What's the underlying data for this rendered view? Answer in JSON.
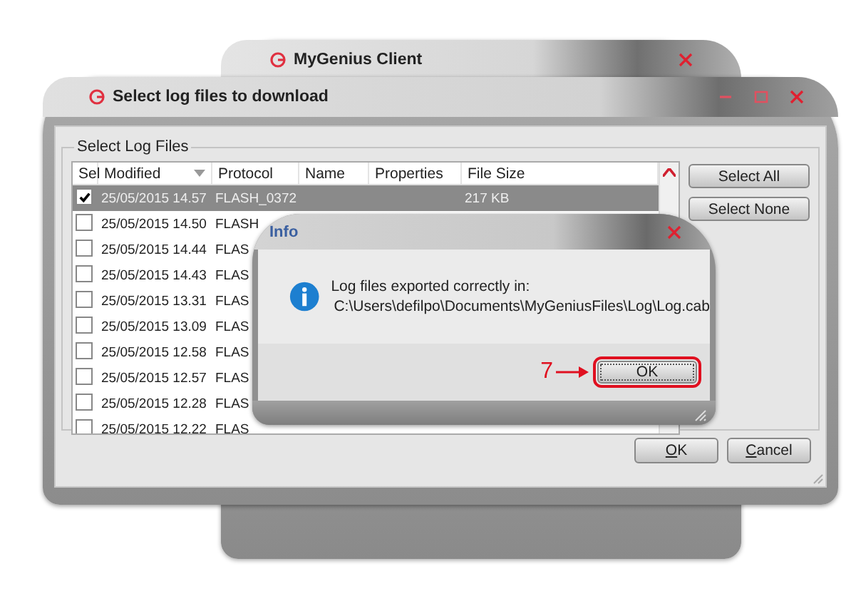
{
  "back_window": {
    "title": "MyGenius Client"
  },
  "main_window": {
    "title": "Select log files to download",
    "group_label": "Select Log Files",
    "columns": [
      {
        "label": "Sel",
        "sorted": false
      },
      {
        "label": "Modified",
        "sorted": true
      },
      {
        "label": "Protocol",
        "sorted": false
      },
      {
        "label": "Name",
        "sorted": false
      },
      {
        "label": "Properties",
        "sorted": false
      },
      {
        "label": "File Size",
        "sorted": false
      }
    ],
    "rows": [
      {
        "checked": true,
        "selected": true,
        "modified": "25/05/2015 14.57",
        "protocol": "FLASH_0372",
        "size": "217 KB"
      },
      {
        "checked": false,
        "selected": false,
        "modified": "25/05/2015 14.50",
        "protocol": "FLASH"
      },
      {
        "checked": false,
        "selected": false,
        "modified": "25/05/2015 14.44",
        "protocol": "FLAS"
      },
      {
        "checked": false,
        "selected": false,
        "modified": "25/05/2015 14.43",
        "protocol": "FLAS"
      },
      {
        "checked": false,
        "selected": false,
        "modified": "25/05/2015 13.31",
        "protocol": "FLAS"
      },
      {
        "checked": false,
        "selected": false,
        "modified": "25/05/2015 13.09",
        "protocol": "FLAS"
      },
      {
        "checked": false,
        "selected": false,
        "modified": "25/05/2015 12.58",
        "protocol": "FLAS"
      },
      {
        "checked": false,
        "selected": false,
        "modified": "25/05/2015 12.57",
        "protocol": "FLAS"
      },
      {
        "checked": false,
        "selected": false,
        "modified": "25/05/2015 12.28",
        "protocol": "FLAS"
      },
      {
        "checked": false,
        "selected": false,
        "modified": "25/05/2015 12.22",
        "protocol": "FLAS"
      }
    ],
    "side_buttons": [
      "Select All",
      "Select None"
    ],
    "buttons": [
      {
        "access_key": "O",
        "rest": "K"
      },
      {
        "access_key": "C",
        "rest": "ancel"
      }
    ]
  },
  "info_dialog": {
    "title": "Info",
    "message": "Log files exported correctly in:",
    "path": "C:\\Users\\defilpo\\Documents\\MyGeniusFiles\\Log\\Log.cab",
    "button": "OK",
    "callout": "7"
  }
}
